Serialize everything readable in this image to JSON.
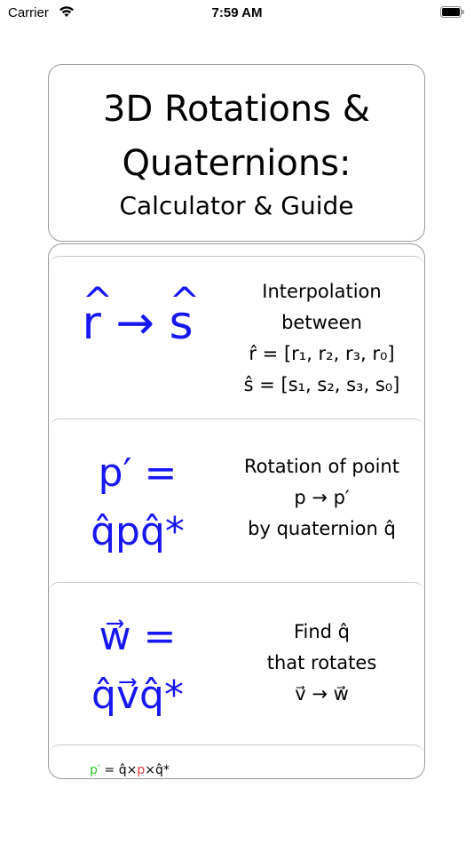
{
  "status": {
    "carrier": "Carrier",
    "time": "7:59 AM"
  },
  "title": {
    "line1": "3D Rotations &",
    "line2": "Quaternions:",
    "subtitle": "Calculator & Guide"
  },
  "items": [
    {
      "formula_a": "r",
      "formula_arrow": " → ",
      "formula_b": "s",
      "desc_line1": "Interpolation",
      "desc_line2": "between",
      "desc_line3": "r̂ = [r₁, r₂, r₃, r₀]",
      "desc_line4": "ŝ = [s₁, s₂, s₃, s₀]"
    },
    {
      "formula_line1": "p′ =",
      "formula_line2": "q̂pq̂*",
      "desc_line1": "Rotation of point",
      "desc_line2": "p → p′",
      "desc_line3": "by quaternion q̂"
    },
    {
      "formula_line1": "w⃗ =",
      "formula_line2": "q̂v⃗q̂*",
      "desc_line1": "Find q̂",
      "desc_line2": "that rotates",
      "desc_line3": "v⃗ → w⃗"
    }
  ],
  "footer": {
    "p_prime": "p′",
    "eq": " = q̂×",
    "p": "p",
    "tail": "×q̂*"
  }
}
